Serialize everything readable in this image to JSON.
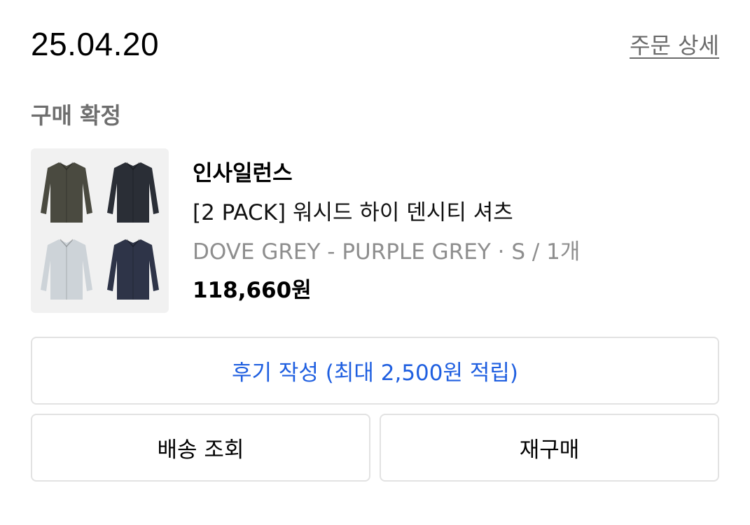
{
  "order": {
    "date": "25.04.20",
    "detail_link": "주문 상세",
    "status": "구매 확정"
  },
  "product": {
    "brand": "인사일런스",
    "name": "[2 PACK] 워시드 하이 덴시티 셔츠",
    "option": "DOVE GREY - PURPLE GREY · S / 1개",
    "price": "118,660원",
    "thumbnail_shirt_colors": [
      "#4a4a40",
      "#2a2e36",
      "#cdd3d8",
      "#2e3448"
    ]
  },
  "actions": {
    "review": "후기 작성 (최대 2,500원 적립)",
    "track": "배송 조회",
    "rebuy": "재구매"
  },
  "colors": {
    "accent": "#1f5fe0",
    "muted_text": "#8e8e8e",
    "border": "#e2e2e2"
  }
}
